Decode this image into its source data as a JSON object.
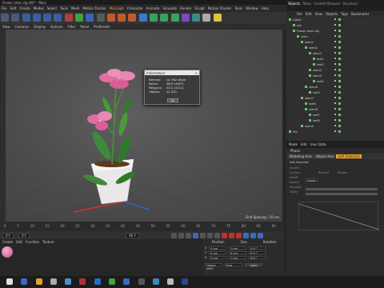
{
  "window": {
    "title": "Flower (stos vlg 46)* - Main"
  },
  "menu": [
    "File",
    "Edit",
    "Create",
    "Modes",
    "Select",
    "Tools",
    "Mesh",
    "Motion Tracker",
    "MoGraph",
    "Character",
    "Animate",
    "Simulate",
    "Render",
    "Sculpt",
    "Motion Tracker",
    "Tools",
    "Window",
    "Help"
  ],
  "menu_highlight": [
    "MoGraph",
    "Pipeline"
  ],
  "layout_label": "Layout:",
  "layout_value": "Startup",
  "view_menu": [
    "View",
    "Cameras",
    "Display",
    "Options",
    "Filter",
    "Panel",
    "ProRender"
  ],
  "viewport": {
    "grid_info": "Grid Spacing : 10 cm"
  },
  "dialog": {
    "title": "Information",
    "close": "×",
    "rows": [
      {
        "k": "Memory:",
        "v": "ca. 562 kByte"
      },
      {
        "k": "Points:",
        "v": "4837 (4837)"
      },
      {
        "k": "Polygons:",
        "v": "4211 (4211)"
      },
      {
        "k": "Objects:",
        "v": "22 (22)"
      }
    ],
    "ok": "Ok"
  },
  "objects_panel": {
    "tabs": [
      "Objects",
      "Takes",
      "Content Browser",
      "Structure"
    ],
    "menu": [
      "File",
      "Edit",
      "View",
      "Objects",
      "Tags",
      "Bookmarks"
    ],
    "items": [
      {
        "name": "Lights",
        "depth": 0
      },
      {
        "name": "pot",
        "depth": 1
      },
      {
        "name": "Flower stem stg",
        "depth": 1
      },
      {
        "name": "stem",
        "depth": 2
      },
      {
        "name": "stem1",
        "depth": 3
      },
      {
        "name": "stem2",
        "depth": 4
      },
      {
        "name": "stem3",
        "depth": 5
      },
      {
        "name": "leaf1",
        "depth": 6
      },
      {
        "name": "leaf2",
        "depth": 6
      },
      {
        "name": "stem4",
        "depth": 5
      },
      {
        "name": "stem5",
        "depth": 5
      },
      {
        "name": "leaf4",
        "depth": 6
      },
      {
        "name": "stem6",
        "depth": 4
      },
      {
        "name": "leaf5",
        "depth": 5
      },
      {
        "name": "stem7",
        "depth": 3
      },
      {
        "name": "leaf6",
        "depth": 4
      },
      {
        "name": "stem8",
        "depth": 4
      },
      {
        "name": "leaf7",
        "depth": 5
      },
      {
        "name": "leaf8",
        "depth": 5
      },
      {
        "name": "stem9",
        "depth": 3
      },
      {
        "name": "Sky",
        "depth": 0
      }
    ]
  },
  "attributes": {
    "menu": [
      "Mode",
      "Edit",
      "User Data"
    ],
    "title": "Phase",
    "tabs": [
      "Modeling Axis",
      "Object Axis",
      "Soft Selection"
    ],
    "section": "Soft Selection",
    "fields": [
      "Enable",
      "Surface",
      "Falloff",
      "Radius",
      "Strength",
      "Width"
    ],
    "fields_right": [
      "Restrict",
      "Rubber"
    ],
    "falloff_value": "Linear"
  },
  "timeline": {
    "ticks": [
      "0",
      "5",
      "10",
      "15",
      "20",
      "25",
      "30",
      "35",
      "40",
      "45",
      "50",
      "55",
      "60",
      "65",
      "70",
      "75",
      "80",
      "85",
      "90"
    ],
    "current": "0 F",
    "start": "0 F",
    "end": "90 F"
  },
  "materials": {
    "menu": [
      "Create",
      "Edit",
      "Function",
      "Texture"
    ]
  },
  "coordinates": {
    "headers": [
      "Position",
      "Size",
      "Rotation"
    ],
    "rows": [
      {
        "axis": "X",
        "pos": "0 cm",
        "size": "0 cm",
        "rot": "H 0 °"
      },
      {
        "axis": "Y",
        "pos": "0 cm",
        "size": "0 cm",
        "rot": "P 0 °"
      },
      {
        "axis": "Z",
        "pos": "0 cm",
        "size": "0 cm",
        "rot": "B 0 °"
      }
    ],
    "mode": "Object (Rel)",
    "size_mode": "Size",
    "apply": "Apply"
  },
  "colors": {
    "accent": "#f5a623",
    "bg": "#262626",
    "panel": "#2b2b2b",
    "viewport": "#4c4c4c",
    "flower": "#e06fa0",
    "leaf": "#3f8a3a",
    "stem_green": "#6ac36a"
  }
}
